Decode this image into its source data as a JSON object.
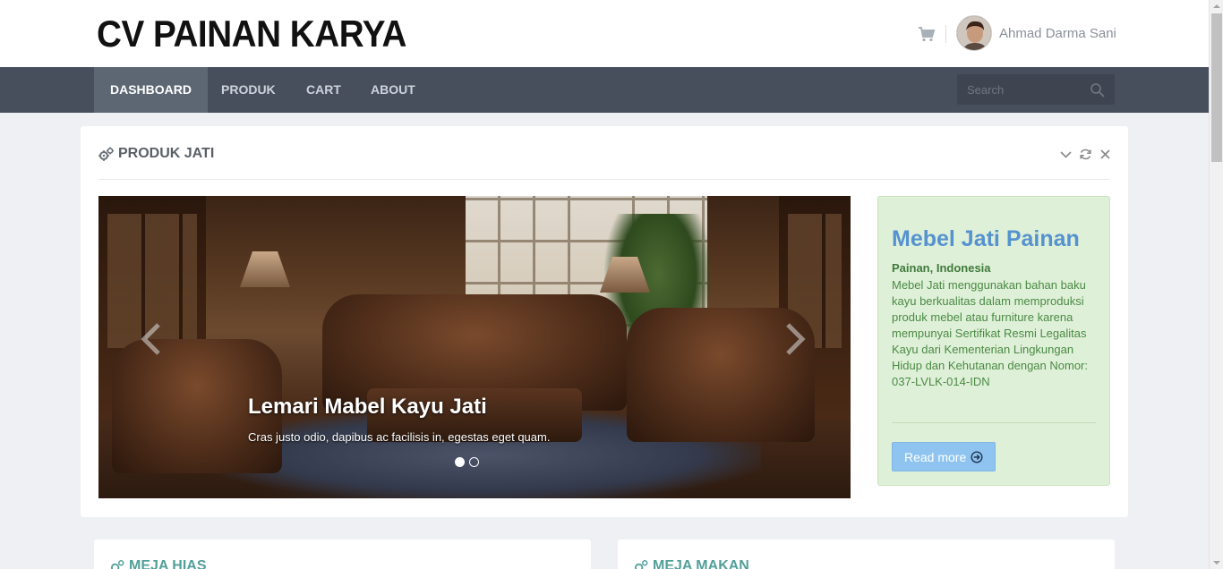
{
  "header": {
    "brand": "CV PAINAN KARYA",
    "user_name": "Ahmad Darma Sani"
  },
  "nav": {
    "items": [
      {
        "label": "DASHBOARD",
        "active": true
      },
      {
        "label": "PRODUK",
        "active": false
      },
      {
        "label": "CART",
        "active": false
      },
      {
        "label": "ABOUT",
        "active": false
      }
    ],
    "search_placeholder": "Search"
  },
  "main_panel": {
    "title": "PRODUK JATI",
    "carousel": {
      "slide_title": "Lemari Mabel Kayu Jati",
      "slide_text": "Cras justo odio, dapibus ac facilisis in, egestas eget quam.",
      "slide_count": 2,
      "active_slide": 1
    },
    "info": {
      "title": "Mebel Jati Painan",
      "location": "Painan, Indonesia",
      "body": "Mebel Jati menggunakan bahan baku kayu berkualitas dalam memproduksi produk mebel atau furniture karena mempunyai Sertifikat Resmi Legalitas Kayu dari Kementerian Lingkungan Hidup dan Kehutanan dengan Nomor: 037-LVLK-014-IDN",
      "button_label": "Read more"
    }
  },
  "bottom_panels": [
    {
      "title": "MEJA HIAS"
    },
    {
      "title": "MEJA MAKAN"
    }
  ],
  "colors": {
    "navbar": "#474f5c",
    "nav_active": "#5d6774",
    "info_bg": "#dff0d8",
    "info_title": "#5592cf",
    "button": "#8ec4ef",
    "section_title": "#53a09a"
  }
}
